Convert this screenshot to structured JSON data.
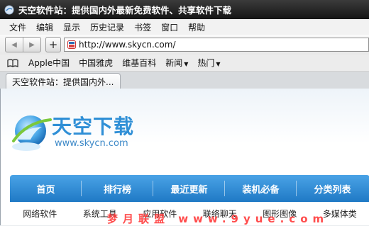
{
  "window": {
    "title": "天空软件站：提供国内外最新免费软件、共享软件下载"
  },
  "menubar": {
    "items": [
      "文件",
      "编辑",
      "显示",
      "历史记录",
      "书签",
      "窗口",
      "帮助"
    ]
  },
  "navbar": {
    "url": "http://www.skycn.com/"
  },
  "bookmarks": {
    "items": [
      "Apple中国",
      "中国雅虎",
      "维基百科",
      "新闻",
      "热门"
    ],
    "dropdown_flags": [
      false,
      false,
      false,
      true,
      true
    ]
  },
  "tabs": [
    {
      "label": "天空软件站：提供国内外..."
    }
  ],
  "page": {
    "logo": {
      "brand": "天空下载",
      "domain": "www.skycn.com"
    },
    "main_nav": [
      "首页",
      "排行榜",
      "最近更新",
      "装机必备",
      "分类列表"
    ],
    "sub_nav": [
      "网络软件",
      "系统工具",
      "应用软件",
      "联络聊天",
      "图形图像",
      "多媒体类"
    ],
    "watermark": "梦月联盟 www.9yue.com"
  }
}
